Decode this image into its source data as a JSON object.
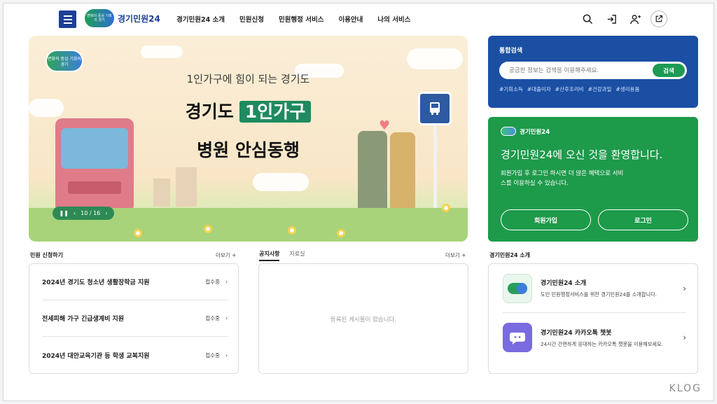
{
  "header": {
    "logo_text": "경기민원24",
    "logo_mark_text": "변화의 중심 기회의 경기",
    "nav": [
      "경기민원24 소개",
      "민원신청",
      "민원행정 서비스",
      "이용안내",
      "나의 서비스"
    ]
  },
  "banner": {
    "logo_mark_text": "변화의 중심 기회의 경기",
    "subtitle": "1인가구에 힘이 되는 경기도",
    "title_prefix": "경기도",
    "title_highlight": "1인가구",
    "title_line2": "병원 안심동행",
    "pager": "10 / 16"
  },
  "search": {
    "title": "통합검색",
    "placeholder": "궁금한 정보는 검색을 이용해주세요.",
    "button": "검색",
    "tags": [
      "#기회소득",
      "#대출이자",
      "#산후조리비",
      "#건강과일",
      "#생리용품"
    ]
  },
  "welcome": {
    "logo_text": "경기민원24",
    "title": "경기민원24에 오신 것을 환영합니다.",
    "desc": "회원가입 후 로그인 하시면 더 많은 혜택으로 서비스를 이용하실 수 있습니다.",
    "signup": "회원가입",
    "login": "로그인"
  },
  "applications": {
    "title": "민원 신청하기",
    "more": "더보기 +",
    "items": [
      {
        "title": "2024년 경기도 청소년 생활장학금 지원",
        "status": "접수중"
      },
      {
        "title": "전세피해 가구 긴급생계비 지원",
        "status": "접수중"
      },
      {
        "title": "2024년 대안교육기관 등 학생 교복지원",
        "status": "접수중"
      }
    ]
  },
  "notices": {
    "tabs": [
      "공지사항",
      "자료실"
    ],
    "more": "더보기 +",
    "empty": "등록된 게시물이 없습니다."
  },
  "intro": {
    "title": "경기민원24 소개",
    "items": [
      {
        "title": "경기민원24 소개",
        "desc": "도민 민원행정서비스를 위한 경기민원24를 소개합니다."
      },
      {
        "title": "경기민원24 카카오톡 챗봇",
        "desc": "24시간 간편하게 응대하는 카카오톡 챗봇을 이용해보세요."
      }
    ]
  },
  "watermark": "KLOG",
  "colors": {
    "brand_blue": "#1a4fa3",
    "brand_green": "#1e9a4b",
    "accent_green": "#1f8a5f"
  }
}
